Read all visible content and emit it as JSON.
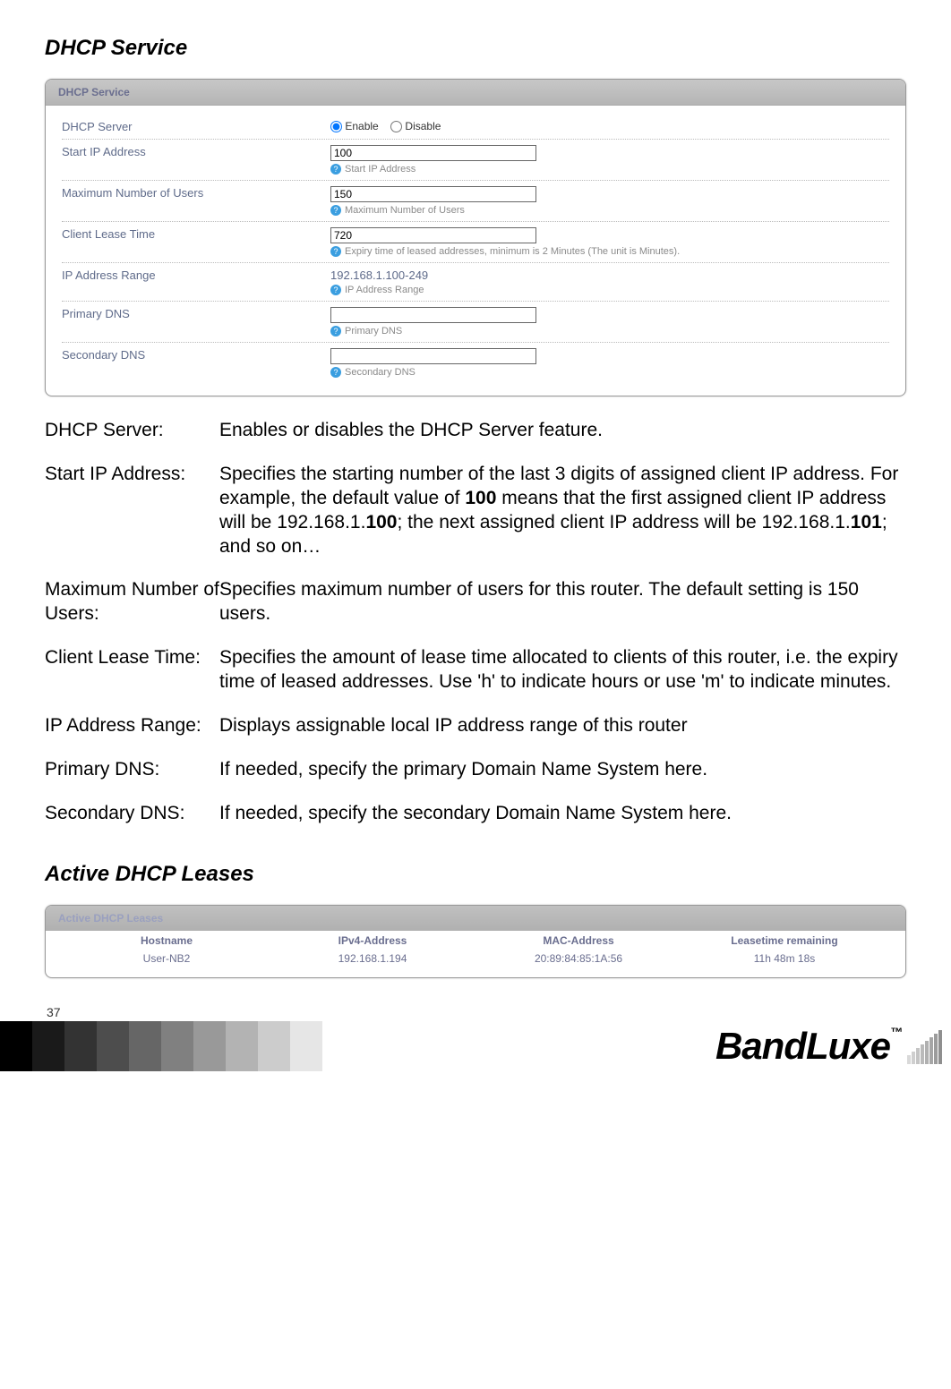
{
  "page_number": "37",
  "section1_title": "DHCP Service",
  "panel1_title": "DHCP Service",
  "form": {
    "dhcp_server_label": "DHCP Server",
    "enable_label": "Enable",
    "disable_label": "Disable",
    "start_ip_label": "Start IP Address",
    "start_ip_value": "100",
    "start_ip_help": "Start IP Address",
    "max_users_label": "Maximum Number of Users",
    "max_users_value": "150",
    "max_users_help": "Maximum Number of Users",
    "lease_time_label": "Client Lease Time",
    "lease_time_value": "720",
    "lease_time_help": "Expiry time of leased addresses, minimum is 2 Minutes (The unit is Minutes).",
    "ip_range_label": "IP Address Range",
    "ip_range_value": "192.168.1.100-249",
    "ip_range_help": "IP Address Range",
    "primary_dns_label": "Primary DNS",
    "primary_dns_value": "",
    "primary_dns_help": "Primary DNS",
    "secondary_dns_label": "Secondary DNS",
    "secondary_dns_value": "",
    "secondary_dns_help": "Secondary DNS"
  },
  "defs": {
    "r1_label": "DHCP Server:",
    "r1_text": "Enables or disables the DHCP Server feature.",
    "r2_label": "Start IP Address:",
    "r2_pre": "Specifies the starting number of the last 3 digits of assigned client IP address. For example, the default value of ",
    "r2_b1": "100",
    "r2_mid1": " means that the first assigned client IP address will be 192.168.1.",
    "r2_b2": "100",
    "r2_mid2": "; the next assigned client IP address will be 192.168.1.",
    "r2_b3": "101",
    "r2_post": "; and so on…",
    "r3_label": "Maximum Number of Users:",
    "r3_text": "Specifies maximum number of users for this router. The default setting is 150 users.",
    "r4_label": "Client Lease Time:",
    "r4_text": "Specifies the amount of lease time allocated to clients of this router, i.e. the expiry time of leased addresses. Use 'h' to indicate hours or use 'm' to indicate minutes.",
    "r5_label": "IP Address Range:",
    "r5_text": "Displays assignable local IP address range of this router",
    "r6_label": "Primary DNS:",
    "r6_text": "If needed, specify the primary Domain Name System here.",
    "r7_label": "Secondary DNS:",
    "r7_text": "If needed, specify the secondary Domain Name System here."
  },
  "section2_title": "Active DHCP Leases",
  "leases_panel_title": "Active DHCP Leases",
  "leases": {
    "col1": "Hostname",
    "col2": "IPv4-Address",
    "col3": "MAC-Address",
    "col4": "Leasetime remaining",
    "row1": {
      "hostname": "User-NB2",
      "ip": "192.168.1.194",
      "mac": "20:89:84:85:1A:56",
      "lease": "11h 48m 18s"
    }
  },
  "logo_text": "BandLuxe",
  "tm": "™"
}
